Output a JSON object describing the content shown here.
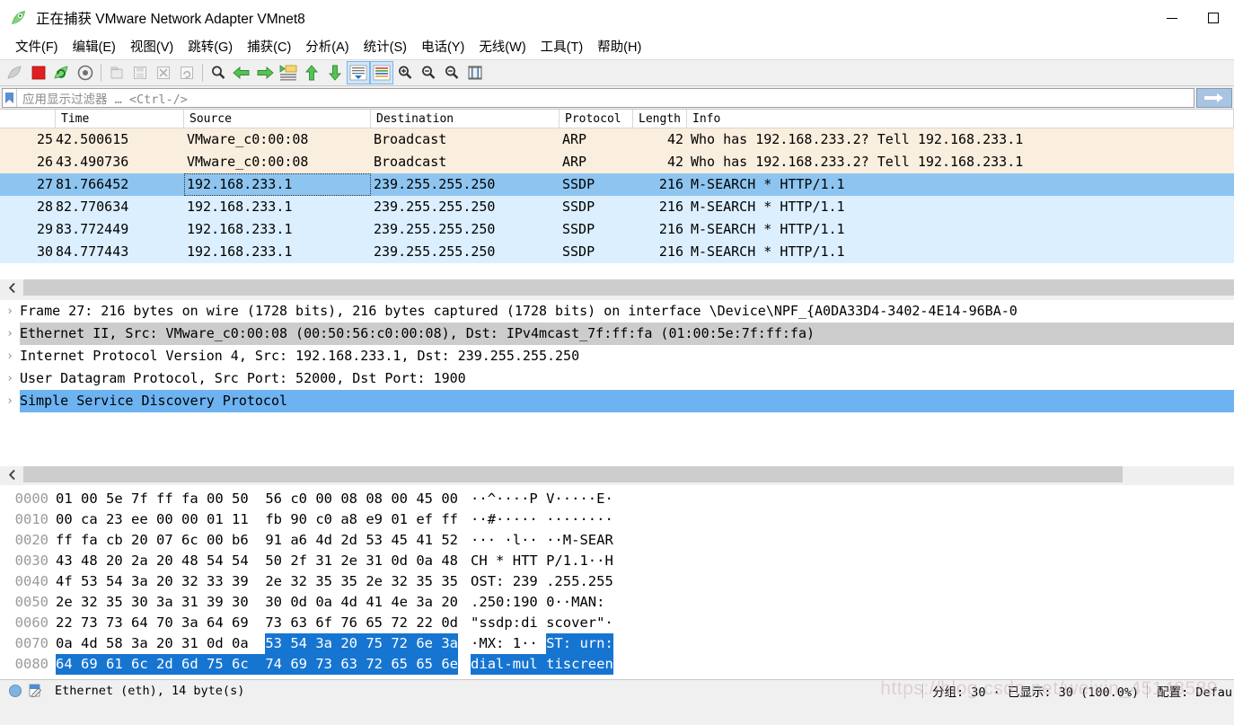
{
  "window": {
    "title": "正在捕获 VMware Network Adapter VMnet8",
    "app_icon": "wireshark-shark-fin-icon",
    "minimize_label": "—",
    "maximize_label": "□"
  },
  "menu": {
    "items": [
      {
        "label": "文件(F)",
        "mnemonic": "F"
      },
      {
        "label": "编辑(E)",
        "mnemonic": "E"
      },
      {
        "label": "视图(V)",
        "mnemonic": "V"
      },
      {
        "label": "跳转(G)",
        "mnemonic": "G"
      },
      {
        "label": "捕获(C)",
        "mnemonic": "C"
      },
      {
        "label": "分析(A)",
        "mnemonic": "A"
      },
      {
        "label": "统计(S)",
        "mnemonic": "S"
      },
      {
        "label": "电话(Y)",
        "mnemonic": "Y"
      },
      {
        "label": "无线(W)",
        "mnemonic": "W"
      },
      {
        "label": "工具(T)",
        "mnemonic": "T"
      },
      {
        "label": "帮助(H)",
        "mnemonic": "H"
      }
    ]
  },
  "toolbar": {
    "items": [
      {
        "name": "start-capture-icon",
        "glyph": "shark-fin",
        "state": "disabled"
      },
      {
        "name": "stop-capture-icon",
        "glyph": "red-square",
        "state": "enabled"
      },
      {
        "name": "restart-capture-icon",
        "glyph": "green-refresh",
        "state": "enabled"
      },
      {
        "name": "capture-options-icon",
        "glyph": "gear",
        "state": "enabled"
      },
      {
        "name": "separator-1",
        "glyph": "separator",
        "state": "none"
      },
      {
        "name": "open-file-icon",
        "glyph": "folder",
        "state": "disabled"
      },
      {
        "name": "save-file-icon",
        "glyph": "floppy",
        "state": "disabled"
      },
      {
        "name": "close-file-icon",
        "glyph": "close-x",
        "state": "disabled"
      },
      {
        "name": "reload-file-icon",
        "glyph": "reload",
        "state": "disabled"
      },
      {
        "name": "separator-2",
        "glyph": "separator",
        "state": "none"
      },
      {
        "name": "find-packet-icon",
        "glyph": "magnifier",
        "state": "enabled"
      },
      {
        "name": "go-back-icon",
        "glyph": "arrow-left-green",
        "state": "enabled"
      },
      {
        "name": "go-forward-icon",
        "glyph": "arrow-right-green",
        "state": "enabled"
      },
      {
        "name": "go-to-packet-icon",
        "glyph": "goto-packet",
        "state": "enabled"
      },
      {
        "name": "go-to-first-packet-icon",
        "glyph": "arrow-up-green",
        "state": "enabled"
      },
      {
        "name": "go-to-last-packet-icon",
        "glyph": "arrow-down-green",
        "state": "enabled"
      },
      {
        "name": "auto-scroll-icon",
        "glyph": "autoscroll",
        "state": "selected"
      },
      {
        "name": "colorize-packets-icon",
        "glyph": "colorize",
        "state": "selected"
      },
      {
        "name": "zoom-in-icon",
        "glyph": "zoom-in",
        "state": "enabled"
      },
      {
        "name": "zoom-out-icon",
        "glyph": "zoom-out",
        "state": "enabled"
      },
      {
        "name": "zoom-reset-icon",
        "glyph": "zoom-reset",
        "state": "enabled"
      },
      {
        "name": "resize-columns-icon",
        "glyph": "resize-columns",
        "state": "enabled"
      }
    ]
  },
  "filter": {
    "bookmark_icon": "bookmark-icon",
    "placeholder": "应用显示过滤器 … <Ctrl-/>",
    "value": "",
    "apply_icon": "arrow-right-icon"
  },
  "packet_list": {
    "columns": [
      {
        "key": "no",
        "label": ""
      },
      {
        "key": "time",
        "label": "Time"
      },
      {
        "key": "source",
        "label": "Source"
      },
      {
        "key": "destination",
        "label": "Destination"
      },
      {
        "key": "protocol",
        "label": "Protocol"
      },
      {
        "key": "length",
        "label": "Length"
      },
      {
        "key": "info",
        "label": "Info"
      }
    ],
    "rows": [
      {
        "no": "25",
        "time": "42.500615",
        "source": "VMware_c0:00:08",
        "destination": "Broadcast",
        "protocol": "ARP",
        "length": "42",
        "info": "Who has 192.168.233.2? Tell 192.168.233.1",
        "style": "arp"
      },
      {
        "no": "26",
        "time": "43.490736",
        "source": "VMware_c0:00:08",
        "destination": "Broadcast",
        "protocol": "ARP",
        "length": "42",
        "info": "Who has 192.168.233.2? Tell 192.168.233.1",
        "style": "arp"
      },
      {
        "no": "27",
        "time": "81.766452",
        "source": "192.168.233.1",
        "destination": "239.255.255.250",
        "protocol": "SSDP",
        "length": "216",
        "info": "M-SEARCH * HTTP/1.1",
        "style": "selected"
      },
      {
        "no": "28",
        "time": "82.770634",
        "source": "192.168.233.1",
        "destination": "239.255.255.250",
        "protocol": "SSDP",
        "length": "216",
        "info": "M-SEARCH * HTTP/1.1",
        "style": "ssdp"
      },
      {
        "no": "29",
        "time": "83.772449",
        "source": "192.168.233.1",
        "destination": "239.255.255.250",
        "protocol": "SSDP",
        "length": "216",
        "info": "M-SEARCH * HTTP/1.1",
        "style": "ssdp"
      },
      {
        "no": "30",
        "time": "84.777443",
        "source": "192.168.233.1",
        "destination": "239.255.255.250",
        "protocol": "SSDP",
        "length": "216",
        "info": "M-SEARCH * HTTP/1.1",
        "style": "ssdp"
      }
    ]
  },
  "packet_detail": {
    "rows": [
      {
        "text": "Frame 27: 216 bytes on wire (1728 bits), 216 bytes captured (1728 bits) on interface \\Device\\NPF_{A0DA33D4-3402-4E14-96BA-0",
        "expander": "›",
        "style": "normal"
      },
      {
        "text": "Ethernet II, Src: VMware_c0:00:08 (00:50:56:c0:00:08), Dst: IPv4mcast_7f:ff:fa (01:00:5e:7f:ff:fa)",
        "expander": "›",
        "style": "hover"
      },
      {
        "text": "Internet Protocol Version 4, Src: 192.168.233.1, Dst: 239.255.255.250",
        "expander": "›",
        "style": "normal"
      },
      {
        "text": "User Datagram Protocol, Src Port: 52000, Dst Port: 1900",
        "expander": "›",
        "style": "normal"
      },
      {
        "text": "Simple Service Discovery Protocol",
        "expander": "›",
        "style": "selected"
      }
    ]
  },
  "hex_dump": {
    "rows": [
      {
        "offset": "0000",
        "bytes": [
          "01",
          "00",
          "5e",
          "7f",
          "ff",
          "fa",
          "00",
          "50",
          "56",
          "c0",
          "00",
          "08",
          "08",
          "00",
          "45",
          "00"
        ],
        "ascii": [
          "·",
          "·",
          "^",
          "·",
          "·",
          "·",
          "·",
          "P",
          "V",
          "·",
          "·",
          "·",
          "·",
          "·",
          "E",
          "·"
        ],
        "sel_from": -1,
        "sel_to": -1
      },
      {
        "offset": "0010",
        "bytes": [
          "00",
          "ca",
          "23",
          "ee",
          "00",
          "00",
          "01",
          "11",
          "fb",
          "90",
          "c0",
          "a8",
          "e9",
          "01",
          "ef",
          "ff"
        ],
        "ascii": [
          "·",
          "·",
          "#",
          "·",
          "·",
          "·",
          "·",
          "·",
          "·",
          "·",
          "·",
          "·",
          "·",
          "·",
          "·",
          "·"
        ],
        "sel_from": -1,
        "sel_to": -1
      },
      {
        "offset": "0020",
        "bytes": [
          "ff",
          "fa",
          "cb",
          "20",
          "07",
          "6c",
          "00",
          "b6",
          "91",
          "a6",
          "4d",
          "2d",
          "53",
          "45",
          "41",
          "52"
        ],
        "ascii": [
          "·",
          "·",
          "·",
          " ",
          "·",
          "l",
          "·",
          "·",
          "·",
          "·",
          "M",
          "-",
          "S",
          "E",
          "A",
          "R"
        ],
        "sel_from": -1,
        "sel_to": -1
      },
      {
        "offset": "0030",
        "bytes": [
          "43",
          "48",
          "20",
          "2a",
          "20",
          "48",
          "54",
          "54",
          "50",
          "2f",
          "31",
          "2e",
          "31",
          "0d",
          "0a",
          "48"
        ],
        "ascii": [
          "C",
          "H",
          " ",
          "*",
          " ",
          "H",
          "T",
          "T",
          "P",
          "/",
          "1",
          ".",
          "1",
          "·",
          "·",
          "H"
        ],
        "sel_from": -1,
        "sel_to": -1
      },
      {
        "offset": "0040",
        "bytes": [
          "4f",
          "53",
          "54",
          "3a",
          "20",
          "32",
          "33",
          "39",
          "2e",
          "32",
          "35",
          "35",
          "2e",
          "32",
          "35",
          "35"
        ],
        "ascii": [
          "O",
          "S",
          "T",
          ":",
          " ",
          "2",
          "3",
          "9",
          ".",
          "2",
          "5",
          "5",
          ".",
          "2",
          "5",
          "5"
        ],
        "sel_from": -1,
        "sel_to": -1
      },
      {
        "offset": "0050",
        "bytes": [
          "2e",
          "32",
          "35",
          "30",
          "3a",
          "31",
          "39",
          "30",
          "30",
          "0d",
          "0a",
          "4d",
          "41",
          "4e",
          "3a",
          "20"
        ],
        "ascii": [
          ".",
          "2",
          "5",
          "0",
          ":",
          "1",
          "9",
          "0",
          "0",
          "·",
          "·",
          "M",
          "A",
          "N",
          ":",
          " "
        ],
        "sel_from": -1,
        "sel_to": -1
      },
      {
        "offset": "0060",
        "bytes": [
          "22",
          "73",
          "73",
          "64",
          "70",
          "3a",
          "64",
          "69",
          "73",
          "63",
          "6f",
          "76",
          "65",
          "72",
          "22",
          "0d"
        ],
        "ascii": [
          "\"",
          "s",
          "s",
          "d",
          "p",
          ":",
          "d",
          "i",
          "s",
          "c",
          "o",
          "v",
          "e",
          "r",
          "\"",
          "·"
        ],
        "sel_from": -1,
        "sel_to": -1
      },
      {
        "offset": "0070",
        "bytes": [
          "0a",
          "4d",
          "58",
          "3a",
          "20",
          "31",
          "0d",
          "0a",
          "53",
          "54",
          "3a",
          "20",
          "75",
          "72",
          "6e",
          "3a"
        ],
        "ascii": [
          "·",
          "M",
          "X",
          ":",
          " ",
          "1",
          "·",
          "·",
          "S",
          "T",
          ":",
          " ",
          "u",
          "r",
          "n",
          ":"
        ],
        "sel_from": 8,
        "sel_to": 15
      },
      {
        "offset": "0080",
        "bytes": [
          "64",
          "69",
          "61",
          "6c",
          "2d",
          "6d",
          "75",
          "6c",
          "74",
          "69",
          "73",
          "63",
          "72",
          "65",
          "65",
          "6e"
        ],
        "ascii": [
          "d",
          "i",
          "a",
          "l",
          "-",
          "m",
          "u",
          "l",
          "t",
          "i",
          "s",
          "c",
          "r",
          "e",
          "e",
          "n"
        ],
        "sel_from": 0,
        "sel_to": 15
      }
    ]
  },
  "status_bar": {
    "ready_icon": "status-ready-icon",
    "expert_icon": "capture-file-properties-icon",
    "left_text": "Ethernet (eth), 14 byte(s)",
    "packets_text": "分组: 30 · 已显示: 30 (100.0%)",
    "profile_text": "配置: Defau",
    "watermark": "https://blog.csdn.net/weixin_45148589"
  },
  "colors": {
    "selected_row": "#8ec5f0",
    "ssdp_row": "#dcefff",
    "arp_row": "#faeede",
    "hex_selection": "#1675d1",
    "detail_selected": "#6db3f2",
    "detail_hover": "#cccccc",
    "accent": "#4a90d9"
  }
}
